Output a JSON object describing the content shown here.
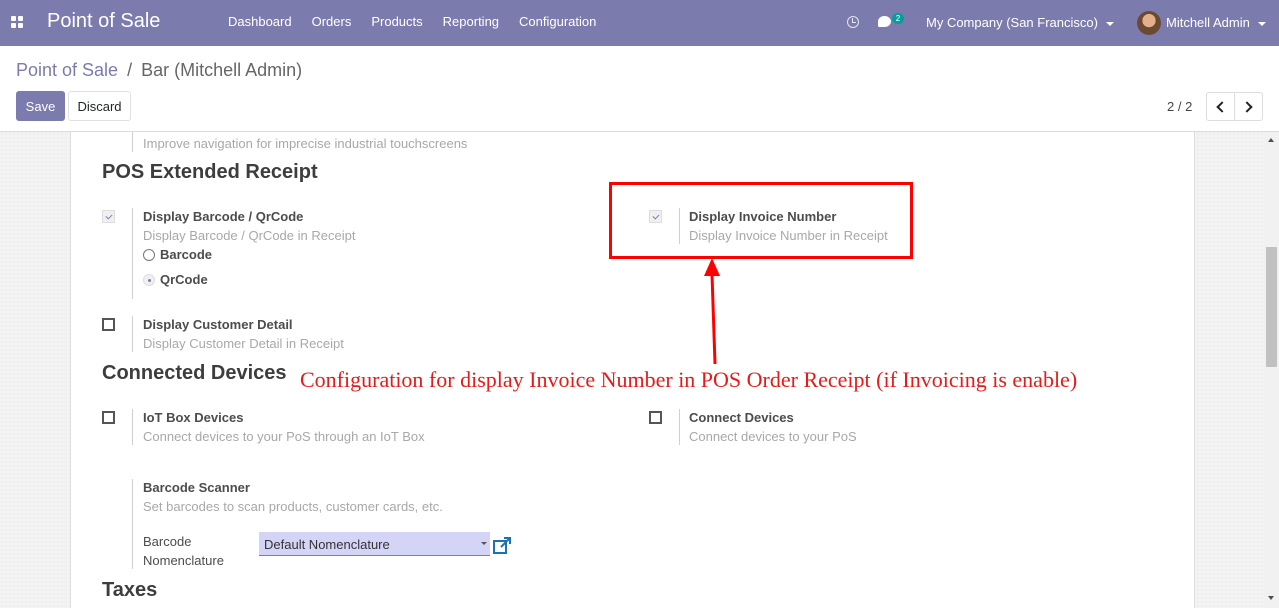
{
  "navbar": {
    "brand": "Point of Sale",
    "menu": [
      "Dashboard",
      "Orders",
      "Products",
      "Reporting",
      "Configuration"
    ],
    "chat_count": "2",
    "company": "My Company (San Francisco)",
    "user": "Mitchell Admin"
  },
  "breadcrumb": {
    "parent": "Point of Sale",
    "separator": "/",
    "current": "Bar (Mitchell Admin)"
  },
  "buttons": {
    "save": "Save",
    "discard": "Discard"
  },
  "pager": {
    "value": "2 / 2"
  },
  "form": {
    "prev_setting_desc": "Improve navigation for imprecise industrial touchscreens",
    "section_receipt": "POS Extended Receipt",
    "barcode_setting": {
      "label": "Display Barcode / QrCode",
      "desc": "Display Barcode / QrCode in Receipt",
      "checked": true,
      "options": [
        "Barcode",
        "QrCode"
      ],
      "selected": "QrCode"
    },
    "invoice_setting": {
      "label": "Display Invoice Number",
      "desc": "Display Invoice Number in Receipt",
      "checked": true
    },
    "customer_setting": {
      "label": "Display Customer Detail",
      "desc": "Display Customer Detail in Receipt",
      "checked": false
    },
    "section_devices": "Connected Devices",
    "iot_setting": {
      "label": "IoT Box Devices",
      "desc": "Connect devices to your PoS through an IoT Box",
      "checked": false
    },
    "connect_setting": {
      "label": "Connect Devices",
      "desc": "Connect devices to your PoS",
      "checked": false
    },
    "scanner_setting": {
      "label": "Barcode Scanner",
      "desc": "Set barcodes to scan products, customer cards, etc.",
      "nomenclature_label_1": "Barcode",
      "nomenclature_label_2": "Nomenclature",
      "nomenclature_value": "Default Nomenclature"
    },
    "section_taxes": "Taxes"
  },
  "annotation": {
    "text": "Configuration for display Invoice Number in POS Order Receipt (if Invoicing is enable)",
    "color": "#ff0000"
  },
  "colors": {
    "primary": "#7c7bad",
    "field_bg": "#d4d4f7"
  }
}
